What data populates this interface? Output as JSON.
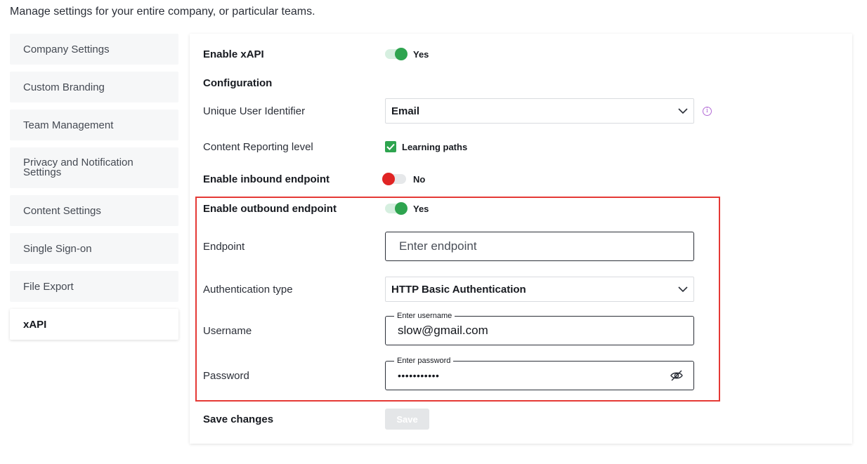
{
  "page": {
    "description": "Manage settings for your entire company, or particular teams."
  },
  "sidebar": {
    "items": [
      {
        "label": "Company Settings"
      },
      {
        "label": "Custom Branding"
      },
      {
        "label": "Team Management"
      },
      {
        "label": "Privacy and Notification Settings"
      },
      {
        "label": "Content Settings"
      },
      {
        "label": "Single Sign-on"
      },
      {
        "label": "File Export"
      },
      {
        "label": "xAPI",
        "active": true
      }
    ]
  },
  "xapi": {
    "enable": {
      "label": "Enable xAPI",
      "value": "Yes",
      "state": "on"
    },
    "configuration_heading": "Configuration",
    "identifier": {
      "label": "Unique User Identifier",
      "value": "Email",
      "info_icon": "info-icon"
    },
    "reporting": {
      "label": "Content Reporting level",
      "option": "Learning paths",
      "checked": true
    },
    "inbound": {
      "label": "Enable inbound endpoint",
      "value": "No",
      "state": "off"
    },
    "outbound": {
      "label": "Enable outbound endpoint",
      "value": "Yes",
      "state": "on"
    },
    "endpoint": {
      "label": "Endpoint",
      "placeholder": "Enter endpoint"
    },
    "auth_type": {
      "label": "Authentication type",
      "value": "HTTP Basic Authentication"
    },
    "username": {
      "label": "Username",
      "field_label": "Enter username",
      "value": "slow@gmail.com"
    },
    "password": {
      "label": "Password",
      "field_label": "Enter password",
      "value": "•••••••••••",
      "icon": "eye-off-icon"
    },
    "save": {
      "label": "Save changes",
      "button": "Save"
    }
  },
  "colors": {
    "toggle_on": "#2ea44f",
    "toggle_off": "#e02424",
    "highlight_border": "#e53935",
    "info_icon": "#b36bd6"
  }
}
